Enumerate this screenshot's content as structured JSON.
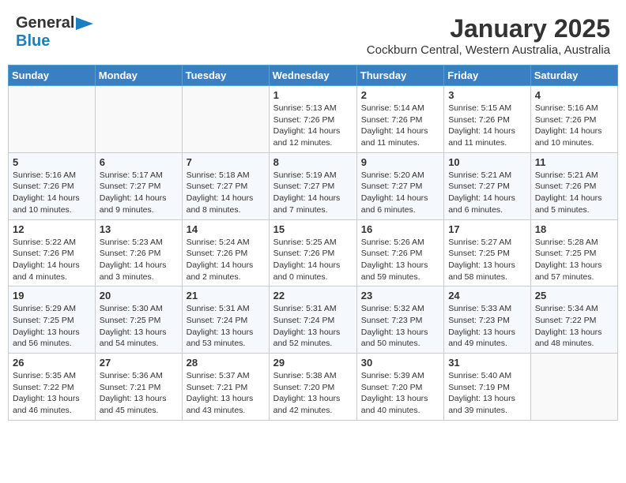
{
  "header": {
    "logo_line1": "General",
    "logo_line2": "Blue",
    "month": "January 2025",
    "location": "Cockburn Central, Western Australia, Australia"
  },
  "weekdays": [
    "Sunday",
    "Monday",
    "Tuesday",
    "Wednesday",
    "Thursday",
    "Friday",
    "Saturday"
  ],
  "weeks": [
    [
      {
        "day": "",
        "info": ""
      },
      {
        "day": "",
        "info": ""
      },
      {
        "day": "",
        "info": ""
      },
      {
        "day": "1",
        "info": "Sunrise: 5:13 AM\nSunset: 7:26 PM\nDaylight: 14 hours and 12 minutes."
      },
      {
        "day": "2",
        "info": "Sunrise: 5:14 AM\nSunset: 7:26 PM\nDaylight: 14 hours and 11 minutes."
      },
      {
        "day": "3",
        "info": "Sunrise: 5:15 AM\nSunset: 7:26 PM\nDaylight: 14 hours and 11 minutes."
      },
      {
        "day": "4",
        "info": "Sunrise: 5:16 AM\nSunset: 7:26 PM\nDaylight: 14 hours and 10 minutes."
      }
    ],
    [
      {
        "day": "5",
        "info": "Sunrise: 5:16 AM\nSunset: 7:26 PM\nDaylight: 14 hours and 10 minutes."
      },
      {
        "day": "6",
        "info": "Sunrise: 5:17 AM\nSunset: 7:27 PM\nDaylight: 14 hours and 9 minutes."
      },
      {
        "day": "7",
        "info": "Sunrise: 5:18 AM\nSunset: 7:27 PM\nDaylight: 14 hours and 8 minutes."
      },
      {
        "day": "8",
        "info": "Sunrise: 5:19 AM\nSunset: 7:27 PM\nDaylight: 14 hours and 7 minutes."
      },
      {
        "day": "9",
        "info": "Sunrise: 5:20 AM\nSunset: 7:27 PM\nDaylight: 14 hours and 6 minutes."
      },
      {
        "day": "10",
        "info": "Sunrise: 5:21 AM\nSunset: 7:27 PM\nDaylight: 14 hours and 6 minutes."
      },
      {
        "day": "11",
        "info": "Sunrise: 5:21 AM\nSunset: 7:26 PM\nDaylight: 14 hours and 5 minutes."
      }
    ],
    [
      {
        "day": "12",
        "info": "Sunrise: 5:22 AM\nSunset: 7:26 PM\nDaylight: 14 hours and 4 minutes."
      },
      {
        "day": "13",
        "info": "Sunrise: 5:23 AM\nSunset: 7:26 PM\nDaylight: 14 hours and 3 minutes."
      },
      {
        "day": "14",
        "info": "Sunrise: 5:24 AM\nSunset: 7:26 PM\nDaylight: 14 hours and 2 minutes."
      },
      {
        "day": "15",
        "info": "Sunrise: 5:25 AM\nSunset: 7:26 PM\nDaylight: 14 hours and 0 minutes."
      },
      {
        "day": "16",
        "info": "Sunrise: 5:26 AM\nSunset: 7:26 PM\nDaylight: 13 hours and 59 minutes."
      },
      {
        "day": "17",
        "info": "Sunrise: 5:27 AM\nSunset: 7:25 PM\nDaylight: 13 hours and 58 minutes."
      },
      {
        "day": "18",
        "info": "Sunrise: 5:28 AM\nSunset: 7:25 PM\nDaylight: 13 hours and 57 minutes."
      }
    ],
    [
      {
        "day": "19",
        "info": "Sunrise: 5:29 AM\nSunset: 7:25 PM\nDaylight: 13 hours and 56 minutes."
      },
      {
        "day": "20",
        "info": "Sunrise: 5:30 AM\nSunset: 7:25 PM\nDaylight: 13 hours and 54 minutes."
      },
      {
        "day": "21",
        "info": "Sunrise: 5:31 AM\nSunset: 7:24 PM\nDaylight: 13 hours and 53 minutes."
      },
      {
        "day": "22",
        "info": "Sunrise: 5:31 AM\nSunset: 7:24 PM\nDaylight: 13 hours and 52 minutes."
      },
      {
        "day": "23",
        "info": "Sunrise: 5:32 AM\nSunset: 7:23 PM\nDaylight: 13 hours and 50 minutes."
      },
      {
        "day": "24",
        "info": "Sunrise: 5:33 AM\nSunset: 7:23 PM\nDaylight: 13 hours and 49 minutes."
      },
      {
        "day": "25",
        "info": "Sunrise: 5:34 AM\nSunset: 7:22 PM\nDaylight: 13 hours and 48 minutes."
      }
    ],
    [
      {
        "day": "26",
        "info": "Sunrise: 5:35 AM\nSunset: 7:22 PM\nDaylight: 13 hours and 46 minutes."
      },
      {
        "day": "27",
        "info": "Sunrise: 5:36 AM\nSunset: 7:21 PM\nDaylight: 13 hours and 45 minutes."
      },
      {
        "day": "28",
        "info": "Sunrise: 5:37 AM\nSunset: 7:21 PM\nDaylight: 13 hours and 43 minutes."
      },
      {
        "day": "29",
        "info": "Sunrise: 5:38 AM\nSunset: 7:20 PM\nDaylight: 13 hours and 42 minutes."
      },
      {
        "day": "30",
        "info": "Sunrise: 5:39 AM\nSunset: 7:20 PM\nDaylight: 13 hours and 40 minutes."
      },
      {
        "day": "31",
        "info": "Sunrise: 5:40 AM\nSunset: 7:19 PM\nDaylight: 13 hours and 39 minutes."
      },
      {
        "day": "",
        "info": ""
      }
    ]
  ]
}
